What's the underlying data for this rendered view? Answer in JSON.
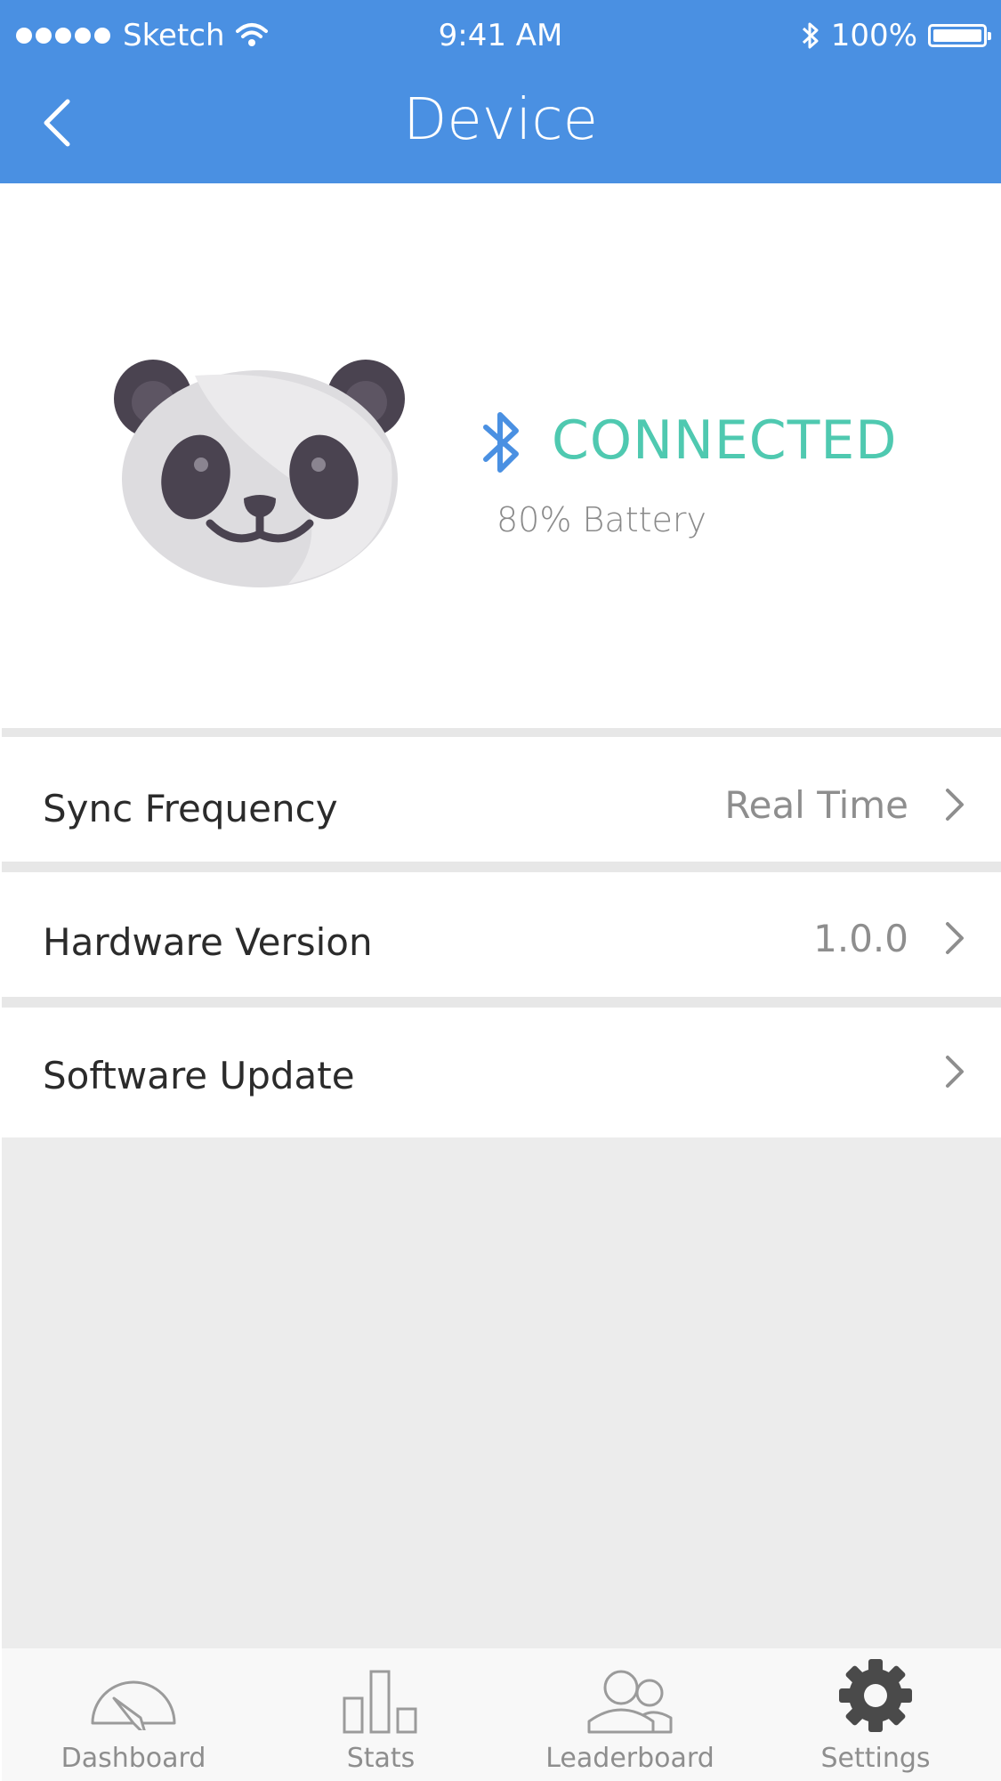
{
  "status_bar": {
    "carrier": "Sketch",
    "time": "9:41 AM",
    "battery": "100%"
  },
  "nav": {
    "title": "Device",
    "back_icon": "chevron-left-icon"
  },
  "device": {
    "avatar": "panda-icon",
    "status": "CONNECTED",
    "status_color": "#4fc9b0",
    "battery_text": "80% Battery",
    "bluetooth_color": "#4a90e2"
  },
  "settings": [
    {
      "label": "Sync Frequency",
      "value": "Real Time"
    },
    {
      "label": "Hardware Version",
      "value": "1.0.0"
    },
    {
      "label": "Software Update",
      "value": ""
    }
  ],
  "tabs": [
    {
      "label": "Dashboard",
      "icon": "gauge-icon",
      "active": false
    },
    {
      "label": "Stats",
      "icon": "bar-chart-icon",
      "active": false
    },
    {
      "label": "Leaderboard",
      "icon": "users-icon",
      "active": false
    },
    {
      "label": "Settings",
      "icon": "gear-icon",
      "active": true
    }
  ],
  "colors": {
    "header": "#4a90e2",
    "background_fill": "#ececec"
  }
}
